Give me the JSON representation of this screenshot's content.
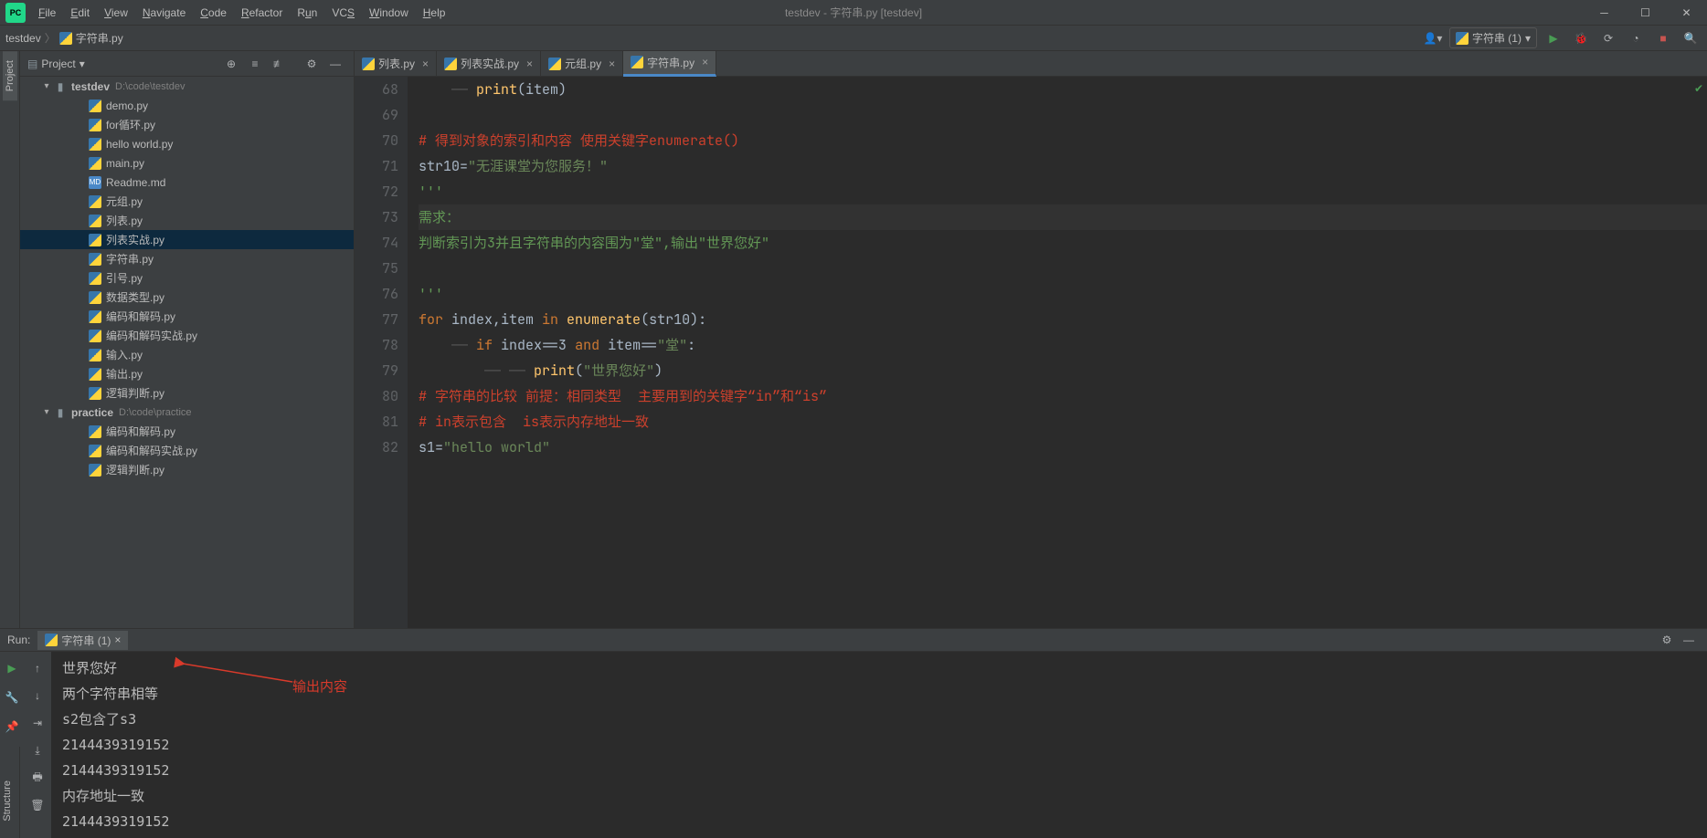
{
  "app": {
    "title": "testdev - 字符串.py [testdev]"
  },
  "menu": {
    "file": "File",
    "edit": "Edit",
    "view": "View",
    "navigate": "Navigate",
    "code": "Code",
    "refactor": "Refactor",
    "run": "Run",
    "vcs": "VCS",
    "window": "Window",
    "help": "Help"
  },
  "breadcrumb": {
    "project": "testdev",
    "file": "字符串.py"
  },
  "runconfig": {
    "name": "字符串 (1)"
  },
  "sidebar": {
    "title": "Project",
    "projectTab": "Project",
    "structureTab": "Structure"
  },
  "tree": {
    "root": {
      "name": "testdev",
      "path": "D:\\code\\testdev"
    },
    "files": [
      "demo.py",
      "for循环.py",
      "hello world.py",
      "main.py",
      "Readme.md",
      "元组.py",
      "列表.py",
      "列表实战.py",
      "字符串.py",
      "引号.py",
      "数据类型.py",
      "编码和解码.py",
      "编码和解码实战.py",
      "输入.py",
      "输出.py",
      "逻辑判断.py"
    ],
    "root2": {
      "name": "practice",
      "path": "D:\\code\\practice"
    },
    "files2": [
      "编码和解码.py",
      "编码和解码实战.py",
      "逻辑判断.py"
    ]
  },
  "tabs": [
    {
      "label": "列表.py"
    },
    {
      "label": "列表实战.py"
    },
    {
      "label": "元组.py"
    },
    {
      "label": "字符串.py"
    }
  ],
  "code": {
    "startLine": 68,
    "lines": [
      {
        "n": 68,
        "t": "code",
        "indent": "    ",
        "dash": "—— ",
        "fn": "print",
        "paren1": "(",
        "id": "item",
        "paren2": ")"
      },
      {
        "n": 69,
        "t": "blank"
      },
      {
        "n": 70,
        "t": "cmt",
        "text": "# 得到对象的索引和内容 使用关键字enumerate()"
      },
      {
        "n": 71,
        "t": "assign",
        "id": "str10",
        "eq": "=",
        "str": "\"无涯课堂为您服务！\""
      },
      {
        "n": 72,
        "t": "docq",
        "text": "'''"
      },
      {
        "n": 73,
        "t": "doc",
        "text": "需求：",
        "hl": true
      },
      {
        "n": 74,
        "t": "doc",
        "text": "判断索引为3并且字符串的内容围为\"堂\",输出\"世界您好\""
      },
      {
        "n": 75,
        "t": "blank"
      },
      {
        "n": 76,
        "t": "docq",
        "text": "'''"
      },
      {
        "n": 77,
        "t": "for",
        "kw1": "for",
        "id1": "index",
        "comma": ",",
        "id2": "item",
        "kw2": "in",
        "fn": "enumerate",
        "arg": "str10"
      },
      {
        "n": 78,
        "t": "if",
        "indent": "    ",
        "dash": "—— ",
        "kw": "if",
        "expr": "index==3 ",
        "kw2": "and",
        "expr2": " item==",
        "str": "\"堂\"",
        "colon": ":"
      },
      {
        "n": 79,
        "t": "print2",
        "indent": "        ",
        "dash": "—— —— ",
        "fn": "print",
        "str": "\"世界您好\""
      },
      {
        "n": 80,
        "t": "cmt",
        "text": "# 字符串的比较 前提：相同类型  主要用到的关键字“in”和“is”"
      },
      {
        "n": 81,
        "t": "cmt",
        "text": "# in表示包含  is表示内存地址一致"
      },
      {
        "n": 82,
        "t": "assign",
        "id": "s1",
        "eq": "=",
        "str": "\"hello world\""
      }
    ]
  },
  "run": {
    "label": "Run:",
    "tabName": "字符串 (1)",
    "output": [
      "世界您好",
      "两个字符串相等",
      "s2包含了s3",
      "2144439319152",
      "2144439319152",
      "内存地址一致",
      "2144439319152"
    ],
    "annotation": "输出内容"
  }
}
